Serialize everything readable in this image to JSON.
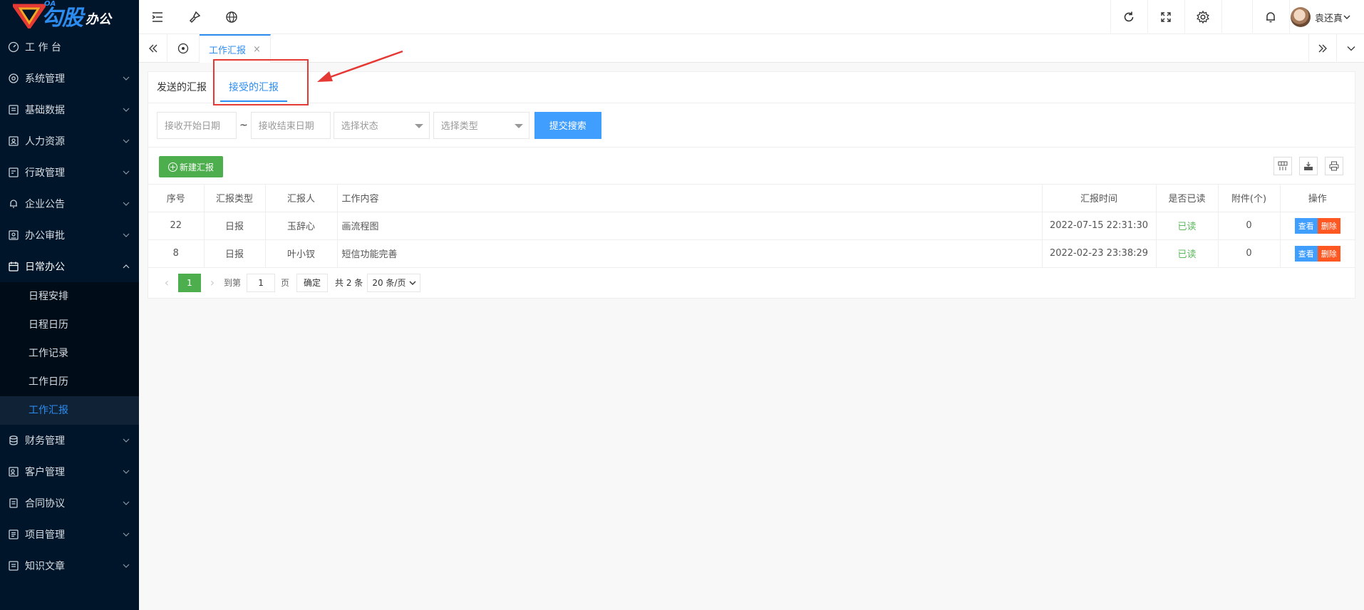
{
  "brand": {
    "oa": "OA",
    "name": "勾股",
    "suffix": "办公"
  },
  "sidebar": {
    "items": [
      {
        "label": "工 作 台",
        "icon": "dashboard-icon",
        "chevron": false
      },
      {
        "label": "系统管理",
        "icon": "settings-icon",
        "chevron": true
      },
      {
        "label": "基础数据",
        "icon": "database-icon",
        "chevron": true
      },
      {
        "label": "人力资源",
        "icon": "user-card-icon",
        "chevron": true
      },
      {
        "label": "行政管理",
        "icon": "admin-icon",
        "chevron": true
      },
      {
        "label": "企业公告",
        "icon": "bell-icon",
        "chevron": true
      },
      {
        "label": "办公审批",
        "icon": "approval-icon",
        "chevron": true
      },
      {
        "label": "日常办公",
        "icon": "calendar-icon",
        "chevron": true,
        "open": true
      }
    ],
    "subitems": [
      "日程安排",
      "日程日历",
      "工作记录",
      "工作日历",
      "工作汇报"
    ],
    "active_sub": "工作汇报",
    "items_after": [
      {
        "label": "财务管理",
        "icon": "finance-icon"
      },
      {
        "label": "客户管理",
        "icon": "customer-icon"
      },
      {
        "label": "合同协议",
        "icon": "contract-icon"
      },
      {
        "label": "项目管理",
        "icon": "project-icon"
      },
      {
        "label": "知识文章",
        "icon": "article-icon"
      }
    ]
  },
  "header": {
    "user_name": "袁还真"
  },
  "tabstrip": {
    "active_tab": "工作汇报",
    "close": "×"
  },
  "page": {
    "tabs": [
      "发送的汇报",
      "接受的汇报"
    ],
    "active_tab": "接受的汇报",
    "filters": {
      "start_date_placeholder": "接收开始日期",
      "tilde": "~",
      "end_date_placeholder": "接收结束日期",
      "status_placeholder": "选择状态",
      "type_placeholder": "选择类型",
      "search_label": "提交搜索"
    },
    "new_button": "新建汇报",
    "table": {
      "headers": [
        "序号",
        "汇报类型",
        "汇报人",
        "工作内容",
        "汇报时间",
        "是否已读",
        "附件(个)",
        "操作"
      ],
      "rows": [
        {
          "id": "22",
          "type": "日报",
          "reporter": "玉辞心",
          "content": "画流程图",
          "time": "2022-07-15 22:31:30",
          "read": "已读",
          "attachments": "0"
        },
        {
          "id": "8",
          "type": "日报",
          "reporter": "叶小钗",
          "content": "短信功能完善",
          "time": "2022-02-23 23:38:29",
          "read": "已读",
          "attachments": "0"
        }
      ],
      "view_label": "查看",
      "delete_label": "删除"
    },
    "pagination": {
      "current": "1",
      "goto_label": "到第",
      "page_input": "1",
      "page_unit": "页",
      "confirm": "确定",
      "total": "共 2 条",
      "per_page": "20 条/页"
    }
  },
  "colors": {
    "sidebar_bg": "#001529",
    "primary": "#2d8cf0",
    "green": "#4cae4c",
    "danger": "#ff5722",
    "highlight": "#e53935"
  }
}
